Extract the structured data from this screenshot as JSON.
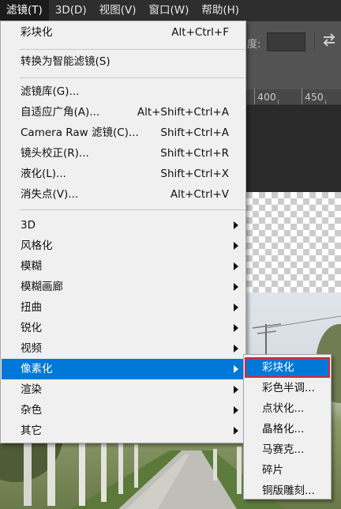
{
  "menubar": {
    "items": [
      {
        "label": "滤镜(T)",
        "active": true
      },
      {
        "label": "3D(D)"
      },
      {
        "label": "视图(V)"
      },
      {
        "label": "窗口(W)"
      },
      {
        "label": "帮助(H)"
      }
    ]
  },
  "options_bar": {
    "density_label": "度:",
    "swap_icon": "swap-arrows-icon"
  },
  "ruler": {
    "labels": [
      "400",
      "450"
    ]
  },
  "filter_menu": {
    "groups": [
      [
        {
          "label": "彩块化",
          "shortcut": "Alt+Ctrl+F"
        }
      ],
      [
        {
          "label": "转换为智能滤镜(S)"
        }
      ],
      [
        {
          "label": "滤镜库(G)..."
        },
        {
          "label": "自适应广角(A)...",
          "shortcut": "Alt+Shift+Ctrl+A"
        },
        {
          "label": "Camera Raw 滤镜(C)...",
          "shortcut": "Shift+Ctrl+A"
        },
        {
          "label": "镜头校正(R)...",
          "shortcut": "Shift+Ctrl+R"
        },
        {
          "label": "液化(L)...",
          "shortcut": "Shift+Ctrl+X"
        },
        {
          "label": "消失点(V)...",
          "shortcut": "Alt+Ctrl+V"
        }
      ],
      [
        {
          "label": "3D",
          "submenu": true
        },
        {
          "label": "风格化",
          "submenu": true
        },
        {
          "label": "模糊",
          "submenu": true
        },
        {
          "label": "模糊画廊",
          "submenu": true
        },
        {
          "label": "扭曲",
          "submenu": true
        },
        {
          "label": "锐化",
          "submenu": true
        },
        {
          "label": "视频",
          "submenu": true
        },
        {
          "label": "像素化",
          "submenu": true,
          "highlighted": true
        },
        {
          "label": "渲染",
          "submenu": true
        },
        {
          "label": "杂色",
          "submenu": true
        },
        {
          "label": "其它",
          "submenu": true
        }
      ]
    ]
  },
  "pixelate_submenu": {
    "items": [
      {
        "label": "彩块化",
        "highlighted": true
      },
      {
        "label": "彩色半调..."
      },
      {
        "label": "点状化..."
      },
      {
        "label": "晶格化..."
      },
      {
        "label": "马赛克..."
      },
      {
        "label": "碎片"
      },
      {
        "label": "铜版雕刻..."
      }
    ]
  },
  "colors": {
    "highlight": "#0078d7",
    "selection_outline": "#e0242f",
    "menu_bg": "#f0f0f0",
    "menubar_bg": "#2e2e2e"
  }
}
